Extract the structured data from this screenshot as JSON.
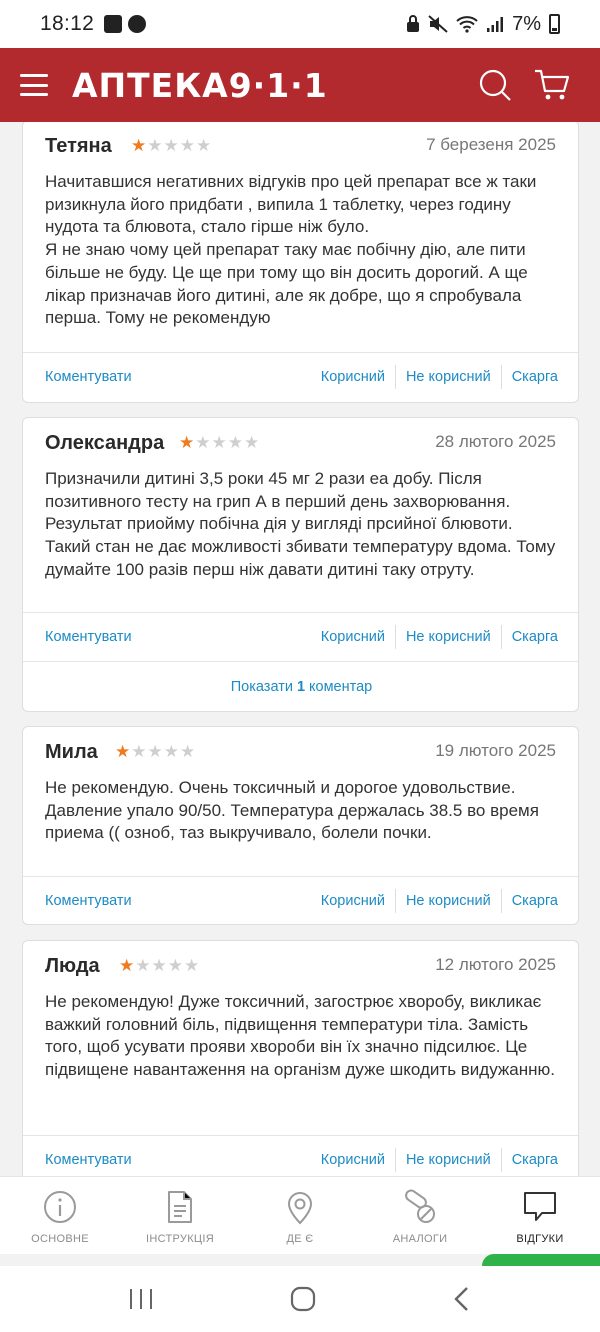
{
  "status_bar": {
    "time": "18:12",
    "battery": "7%"
  },
  "app_bar": {
    "logo": "АПТЕКА9·1·1",
    "brand_color": "#b22a2e"
  },
  "reviews": [
    {
      "author": "Тетяна",
      "rating": 1,
      "date": "7 березеня 2025",
      "text": "Начитавшися негативних відгуків про цей препарат все ж таки ризикнула його придбати , випила 1 таблетку, через годину нудота та блювота, стало гірше ніж було.\nЯ не знаю чому цей препарат таку має побічну дію, але пити більше не буду. Це ще при тому що він досить дорогий. А ще лікар призначав його дитині, але як добре, що я спробувала перша. Тому не рекомендую"
    },
    {
      "author": "Олександра",
      "rating": 1,
      "date": "28 лютого 2025",
      "text": "Призначили дитині 3,5 роки 45 мг 2 рази еа добу. Після позитивного тесту на грип А в перший день захворювання. Результат приойму побічна дія у вигляді прсийної блювоти. Такий стан не дає можливості збивати температуру вдома. Тому думайте 100 разів перш ніж давати дитині таку отруту.",
      "show_comments": {
        "prefix": "Показати",
        "count": "1",
        "suffix": "коментар"
      }
    },
    {
      "author": "Мила",
      "rating": 1,
      "date": "19 лютого 2025",
      "text": "Не рекомендую. Очень токсичный и дорогое удовольствие. Давление упало 90/50. Температура держалась 38.5 во время приема (( озноб, таз выкручивало, болели почки."
    },
    {
      "author": "Люда",
      "rating": 1,
      "date": "12 лютого 2025",
      "text": "Не рекомендую! Дуже токсичний, загострює хворобу, викликає важкий головний біль, підвищення температури тіла. Замість того, щоб усувати прояви хвороби він їх значно підсилює. Це підвищене навантаження на організм дуже шкодить видужанню."
    }
  ],
  "actions": {
    "comment": "Коментувати",
    "useful": "Корисний",
    "not_useful": "Не корисний",
    "complaint": "Скарга"
  },
  "tabs": [
    {
      "label": "ОСНОВНЕ",
      "icon": "info-icon"
    },
    {
      "label": "ІНСТРУКЦІЯ",
      "icon": "document-icon"
    },
    {
      "label": "ДЕ Є",
      "icon": "location-pin-icon"
    },
    {
      "label": "АНАЛОГИ",
      "icon": "pills-icon"
    },
    {
      "label": "ВІДГУКИ",
      "icon": "chat-bubble-icon",
      "active": true
    }
  ],
  "colors": {
    "star_filled": "#f07a1e",
    "star_empty": "#cfcfcf",
    "link": "#1d8bc4",
    "accent_green": "#2fb24a"
  }
}
